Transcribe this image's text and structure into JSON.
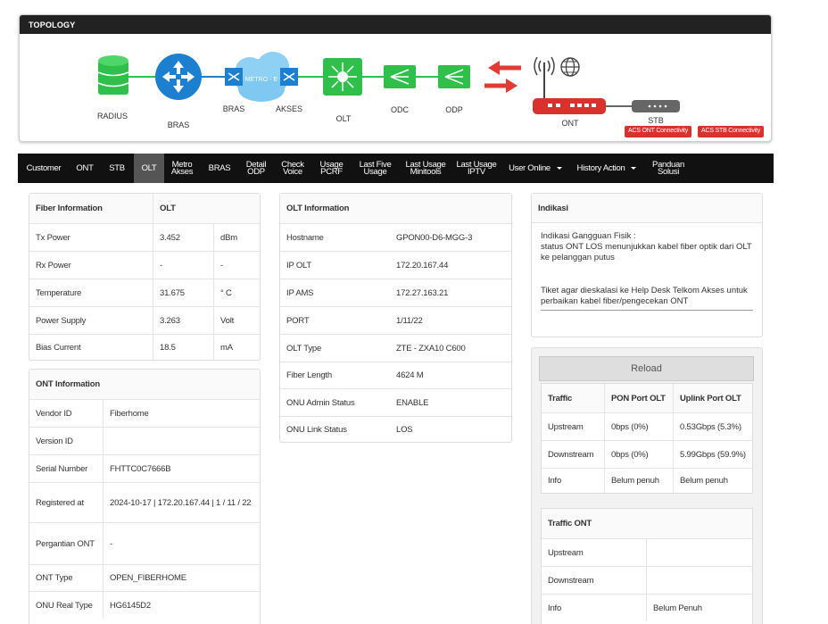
{
  "topology": {
    "title": "TOPOLOGY",
    "nodes": {
      "radius": "RADIUS",
      "bras1": "BRAS",
      "bras2": "BRAS",
      "metro": "METRO - E",
      "akses": "AKSES",
      "olt": "OLT",
      "odc": "ODC",
      "odp": "ODP",
      "ont": "ONT",
      "stb": "STB"
    },
    "acs_ont": "ACS ONT Connectivity",
    "acs_stb": "ACS STB Connectivity",
    "colors": {
      "green": "#2fbf4a",
      "blue": "#1c7fd0",
      "red": "#e13b36",
      "cloud": "#7fc8f2"
    }
  },
  "nav": {
    "customer": "Customer",
    "ont": "ONT",
    "stb": "STB",
    "olt": "OLT",
    "metro1": "Metro",
    "metro2": "Akses",
    "bras": "BRAS",
    "odp1": "Detail",
    "odp2": "ODP",
    "voice1": "Check",
    "voice2": "Voice",
    "pcrf1": "Usage",
    "pcrf2": "PCRF",
    "five1": "Last Five",
    "five2": "Usage",
    "mini1": "Last Usage",
    "mini2": "Minitools",
    "iptv1": "Last Usage",
    "iptv2": "IPTV",
    "user_online": "User Online",
    "history": "History Action",
    "panduan1": "Panduan",
    "panduan2": "Solusi"
  },
  "fiber": {
    "header": [
      "Fiber Information",
      "OLT"
    ],
    "rows": [
      [
        "Tx Power",
        "3.452",
        "dBm"
      ],
      [
        "Rx Power",
        "-",
        "-"
      ],
      [
        "Temperature",
        "31.675",
        "° C"
      ],
      [
        "Power Supply",
        "3.263",
        "Volt"
      ],
      [
        "Bias Current",
        "18.5",
        "mA"
      ]
    ]
  },
  "ont_info": {
    "header": "ONT Information",
    "rows": [
      [
        "Vendor ID",
        "Fiberhome"
      ],
      [
        "Version ID",
        ""
      ],
      [
        "Serial Number",
        "FHTTC0C7666B"
      ],
      [
        "Registered at",
        "2024-10-17 | 172.20.167.44 | 1 / 11 / 22"
      ],
      [
        "Pergantian ONT",
        "-"
      ],
      [
        "ONT Type",
        "OPEN_FIBERHOME"
      ],
      [
        "ONU Real Type",
        "HG6145D2"
      ]
    ]
  },
  "olt_info": {
    "header": "OLT Information",
    "rows": [
      [
        "Hostname",
        "GPON00-D6-MGG-3"
      ],
      [
        "IP OLT",
        "172.20.167.44"
      ],
      [
        "IP AMS",
        "172.27.163.21"
      ],
      [
        "PORT",
        "1/11/22"
      ],
      [
        "OLT Type",
        "ZTE - ZXA10 C600"
      ],
      [
        "Fiber Length",
        "4624 M"
      ],
      [
        "ONU Admin Status",
        "ENABLE"
      ],
      [
        "ONU Link Status",
        "LOS"
      ]
    ]
  },
  "indikasi": {
    "header": "Indikasi",
    "line1": "Indikasi Gangguan Fisik :",
    "line2": "status ONT LOS menunjukkan kabel fiber optik dari OLT ke pelanggan putus",
    "line3": "Tiket agar dieskalasi ke Help Desk Telkom Akses untuk perbaikan kabel fiber/pengecekan ONT"
  },
  "traffic": {
    "reload": "Reload",
    "header": [
      "Traffic",
      "PON Port OLT",
      "Uplink Port OLT"
    ],
    "rows": [
      [
        "Upstream",
        "0bps (0%)",
        "0.53Gbps (5.3%)"
      ],
      [
        "Downstream",
        "0bps (0%)",
        "5.99Gbps (59.9%)"
      ],
      [
        "Info",
        "Belum penuh",
        "Belum penuh"
      ]
    ]
  },
  "traffic_ont": {
    "header": "Traffic ONT",
    "rows": [
      [
        "Upstream",
        ""
      ],
      [
        "Downstream",
        ""
      ],
      [
        "Info",
        "Belum Penuh"
      ]
    ]
  }
}
